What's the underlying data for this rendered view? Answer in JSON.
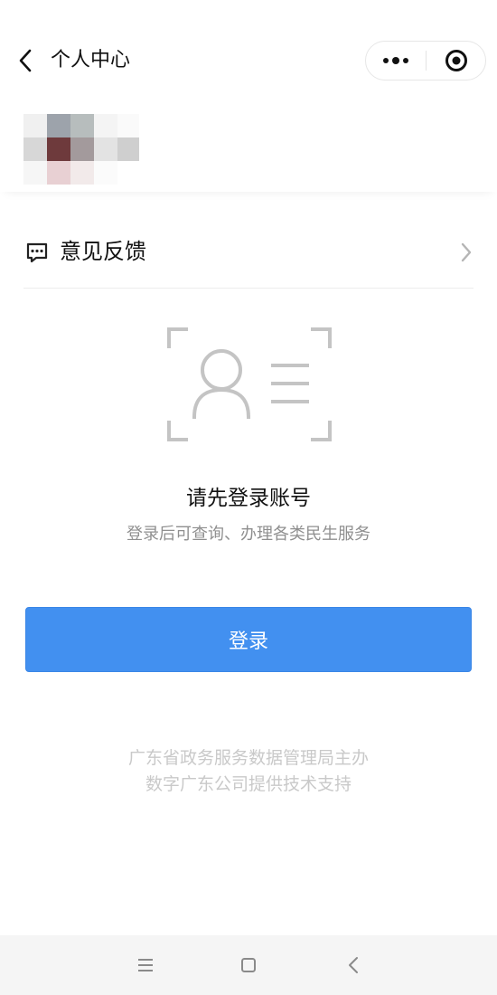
{
  "header": {
    "title": "个人中心",
    "back_icon": "chevron-left-icon",
    "more_icon": "more-dots-icon",
    "close_icon": "target-circle-icon"
  },
  "feedback": {
    "label": "意见反馈",
    "icon": "message-dots-icon",
    "chevron_icon": "chevron-right-icon"
  },
  "login_prompt": {
    "title": "请先登录账号",
    "subtitle": "登录后可查询、办理各类民生服务",
    "illustration_icon": "user-id-scan-icon"
  },
  "login_button": {
    "label": "登录",
    "color": "#4290f0"
  },
  "footer": {
    "line1": "广东省政务服务数据管理局主办",
    "line2": "数字广东公司提供技术支持"
  },
  "system_nav": {
    "menu_icon": "menu-lines-icon",
    "home_icon": "square-home-icon",
    "back_icon": "chevron-left-icon"
  }
}
